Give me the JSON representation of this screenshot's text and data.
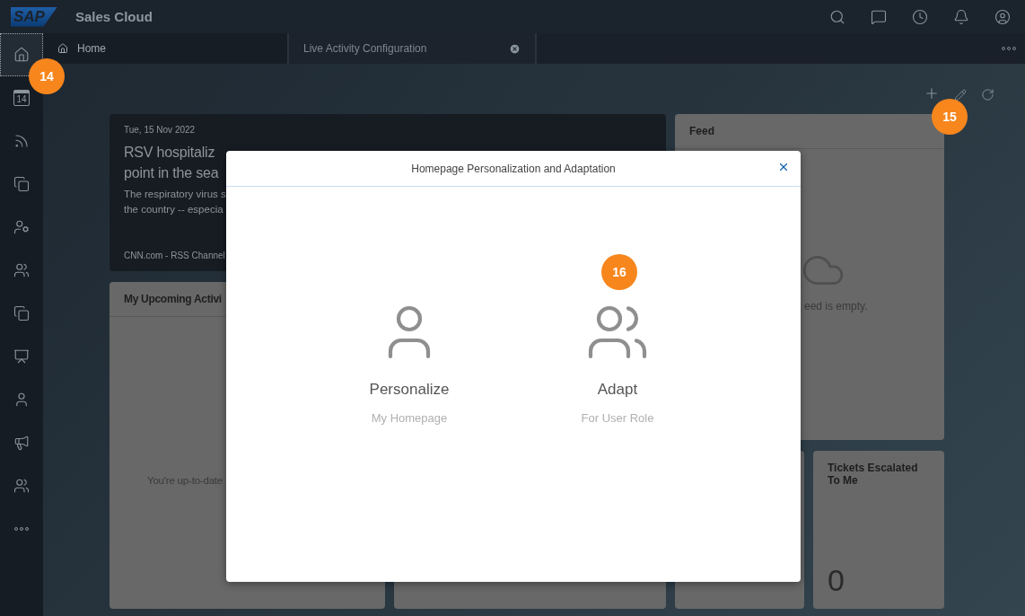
{
  "app": {
    "logo": "SAP",
    "title": "Sales Cloud"
  },
  "tabs": [
    {
      "kind": "home",
      "label": "Home",
      "selected": true
    },
    {
      "kind": "closable",
      "label": "Live Activity Configuration",
      "selected": false
    }
  ],
  "sidebar": {
    "items": [
      {
        "kind": "home",
        "selected": true
      },
      {
        "kind": "calendar",
        "label": "14",
        "selected": false
      },
      {
        "kind": "feed",
        "selected": false
      },
      {
        "kind": "copies",
        "selected": false
      },
      {
        "kind": "settings-user",
        "selected": false
      },
      {
        "kind": "contacts",
        "selected": false
      },
      {
        "kind": "copies",
        "selected": false
      },
      {
        "kind": "team",
        "selected": false
      },
      {
        "kind": "person",
        "selected": false
      },
      {
        "kind": "campaign",
        "selected": false
      },
      {
        "kind": "deals",
        "selected": false
      },
      {
        "kind": "more",
        "selected": false
      }
    ]
  },
  "callouts": [
    "14",
    "15",
    "16"
  ],
  "dashboard": {
    "news": {
      "date": "Tue, 15 Nov 2022",
      "headline_lines": [
        "RSV hospitaliz",
        "point in the sea"
      ],
      "summary_lines": [
        "The respiratory virus s",
        "the country -- especia"
      ],
      "source": "CNN.com - RSS Channel"
    },
    "feed": {
      "title": "Feed",
      "empty_text": "eed is empty."
    },
    "activities": {
      "title": "My Upcoming Activi",
      "empty_text": "You're up-to-date"
    },
    "tickets": {
      "title": "Tickets Escalated To Me",
      "value": "0"
    }
  },
  "dialog": {
    "title": "Homepage Personalization and Adaptation",
    "options": [
      {
        "kind": "person",
        "label": "Personalize",
        "sublabel": "My Homepage"
      },
      {
        "kind": "people",
        "label": "Adapt",
        "sublabel": "For User Role"
      }
    ]
  }
}
